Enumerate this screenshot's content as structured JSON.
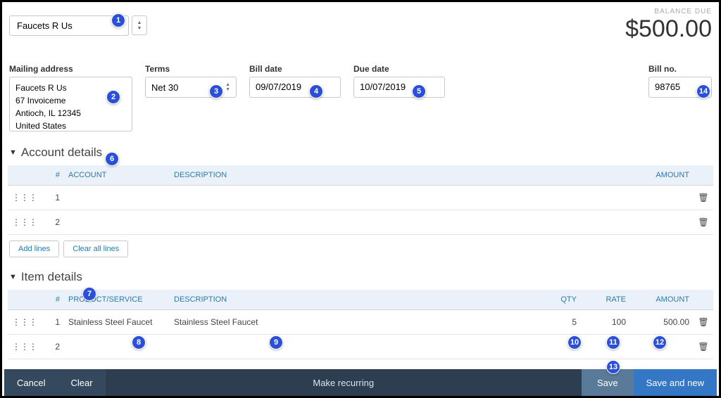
{
  "vendor": {
    "name": "Faucets R Us"
  },
  "balance": {
    "label": "BALANCE DUE",
    "amount": "$500.00"
  },
  "labels": {
    "mailing": "Mailing address",
    "terms": "Terms",
    "billdate": "Bill date",
    "duedate": "Due date",
    "billno": "Bill no."
  },
  "mailing_address": "Faucets R Us\n67 Invoiceme\nAntioch, IL  12345\nUnited States",
  "terms": "Net 30",
  "bill_date": "09/07/2019",
  "due_date": "10/07/2019",
  "bill_no": "98765",
  "sections": {
    "account": "Account details",
    "item": "Item details"
  },
  "account_table": {
    "headers": {
      "num": "#",
      "account": "ACCOUNT",
      "description": "DESCRIPTION",
      "amount": "AMOUNT"
    },
    "rows": [
      {
        "num": "1",
        "account": "",
        "description": "",
        "amount": ""
      },
      {
        "num": "2",
        "account": "",
        "description": "",
        "amount": ""
      }
    ]
  },
  "item_table": {
    "headers": {
      "num": "#",
      "product": "PRODUCT/SERVICE",
      "description": "DESCRIPTION",
      "qty": "QTY",
      "rate": "RATE",
      "amount": "AMOUNT"
    },
    "rows": [
      {
        "num": "1",
        "product": "Stainless Steel Faucet",
        "description": "Stainless Steel Faucet",
        "qty": "5",
        "rate": "100",
        "amount": "500.00"
      },
      {
        "num": "2",
        "product": "",
        "description": "",
        "qty": "",
        "rate": "",
        "amount": ""
      }
    ]
  },
  "buttons": {
    "add_lines": "Add lines",
    "clear_all": "Clear all lines",
    "cancel": "Cancel",
    "clear": "Clear",
    "make_recurring": "Make recurring",
    "save": "Save",
    "save_new": "Save and new"
  },
  "annotations": [
    "1",
    "2",
    "3",
    "4",
    "5",
    "6",
    "7",
    "8",
    "9",
    "10",
    "11",
    "12",
    "13",
    "14"
  ]
}
